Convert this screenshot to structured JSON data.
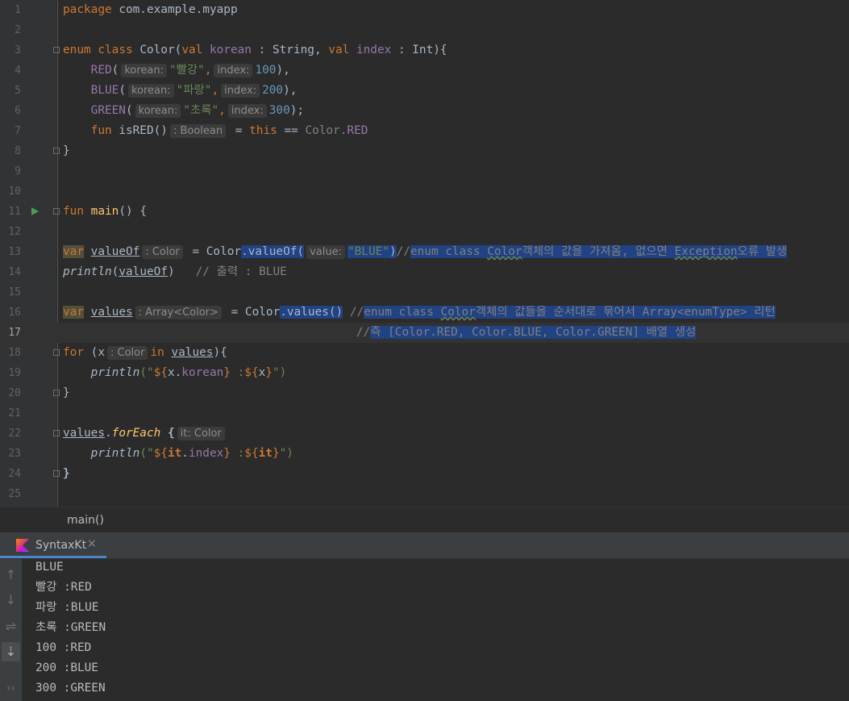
{
  "editor": {
    "line_numbers": [
      "1",
      "2",
      "3",
      "4",
      "5",
      "6",
      "7",
      "8",
      "9",
      "10",
      "11",
      "12",
      "13",
      "14",
      "15",
      "16",
      "17",
      "18",
      "19",
      "20",
      "21",
      "22",
      "23",
      "24",
      "25"
    ],
    "l1": {
      "kw": "package",
      "rest": " com.example.myapp"
    },
    "l3": {
      "kw_enum": "enum",
      "kw_class": "class",
      "name": " Color(",
      "kw_val1": "val",
      "p1": "korean",
      "t1": " : String, ",
      "kw_val2": "val",
      "p2": "index",
      "t2": " : Int){"
    },
    "l4": {
      "entry": "RED",
      "open": "(",
      "h1": "korean:",
      "s": "\"빨강\"",
      "comma": ",",
      "h2": "index:",
      "n": "100",
      "close": "),"
    },
    "l5": {
      "entry": "BLUE",
      "open": "(",
      "h1": "korean:",
      "s": "\"파랑\"",
      "comma": ",",
      "h2": "index:",
      "n": "200",
      "close": "),"
    },
    "l6": {
      "entry": "GREEN",
      "open": "(",
      "h1": "korean:",
      "s": "\"초록\"",
      "comma": ",",
      "h2": "index:",
      "n": "300",
      "close": ");"
    },
    "l7": {
      "kw_fun": "fun",
      "name": " isRED()",
      "hint": ": Boolean",
      "eq": " = ",
      "kw_this": "this",
      "op": " == ",
      "cls": "Color.",
      "entry": "RED"
    },
    "l8": {
      "text": "}"
    },
    "l11": {
      "kw": "fun",
      "name": "main",
      "rest": "() {"
    },
    "l13": {
      "kw": "var",
      "var": "valueOf",
      "hint": ": Color",
      "eq": " = Color",
      "sel": ".valueOf(",
      "h2": "value:",
      "s": "\"BLUE\"",
      "close": ")",
      "cm_slashes": "//",
      "cm_a": "enum class ",
      "cm_b": "Color",
      "cm_c": "객체의 값을 가져옴, 없으면 ",
      "cm_d": "Exception",
      "cm_e": "오류 발생"
    },
    "l14": {
      "fn": "println",
      "open": "(",
      "arg": "valueOf",
      "close": ")",
      "cm": "   // 출력 : BLUE"
    },
    "l16": {
      "kw": "var",
      "var": "values",
      "hint": ": Array<Color>",
      "eq": " = Color",
      "sel": ".values()",
      "sp": " ",
      "cm_slashes": "//",
      "cm_a": "enum class ",
      "cm_b": "Color",
      "cm_c": "객체의 값들을 순서대로 묶어서 Array<enumType> 리턴"
    },
    "l17": {
      "pad": "                                          ",
      "cm_slashes": "//",
      "cm_a": "즉 [Color.RED, Color.BLUE, Color.GREEN] 배열 생성"
    },
    "l18": {
      "kw": "for",
      "a": " (x",
      "hint": ": Color",
      "kw_in": "in",
      "sp": " ",
      "arr": "values",
      "b": "){"
    },
    "l19": {
      "fn": "println",
      "a": "(\"",
      "t1": "${",
      "p": "x.",
      "prop": "korean",
      "t2": "}",
      "s": " :",
      "t3": "${",
      "x": "x",
      "t4": "}",
      "b": "\")"
    },
    "l20": {
      "text": "}"
    },
    "l22": {
      "arr": "values",
      "dot": ".",
      "fn": "forEach",
      "b": " {",
      "hint": "it: Color"
    },
    "l23": {
      "fn": "println",
      "a": "(\"",
      "t1": "${",
      "it": "it",
      "dot": ".",
      "prop": "index",
      "t2": "}",
      "s": " :",
      "t3": "${",
      "it2": "it",
      "t4": "}",
      "b": "\")"
    },
    "l24": {
      "text": "}"
    }
  },
  "breadcrumb": "main()",
  "run_tab": {
    "label": "SyntaxKt",
    "close": "×"
  },
  "console": {
    "lines": [
      "BLUE",
      "빨강 :RED",
      "파랑 :BLUE",
      "초록 :GREEN",
      "100 :RED",
      "200 :BLUE",
      "300 :GREEN"
    ]
  },
  "toolbar": {
    "up": "↑",
    "down": "↓",
    "wrap": "⇌",
    "scroll": "⇣",
    "more": "››"
  }
}
